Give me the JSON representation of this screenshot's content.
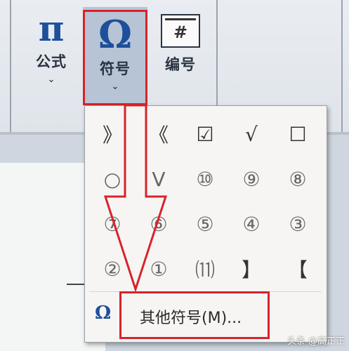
{
  "ribbon": {
    "formula": {
      "icon": "pi-icon",
      "glyph": "π",
      "label": "公式",
      "chevron": "⌄"
    },
    "symbol": {
      "icon": "omega-icon",
      "glyph": "Ω",
      "label": "符号",
      "chevron": "⌄"
    },
    "number": {
      "icon": "numbering-icon",
      "glyph": "#",
      "label": "编号"
    }
  },
  "symbol_menu": {
    "symbols": [
      "》",
      "《",
      "☑",
      "√",
      "☐",
      "○",
      "V",
      "⑩",
      "⑨",
      "⑧",
      "⑦",
      "⑥",
      "⑤",
      "④",
      "③",
      "②",
      "①",
      "⑾",
      "】",
      "【"
    ],
    "more": {
      "icon": "omega-icon",
      "glyph": "Ω",
      "label": "其他符号(M)..."
    }
  },
  "annotation": {
    "color": "#d8232a"
  },
  "watermark": "头条 @高正正"
}
